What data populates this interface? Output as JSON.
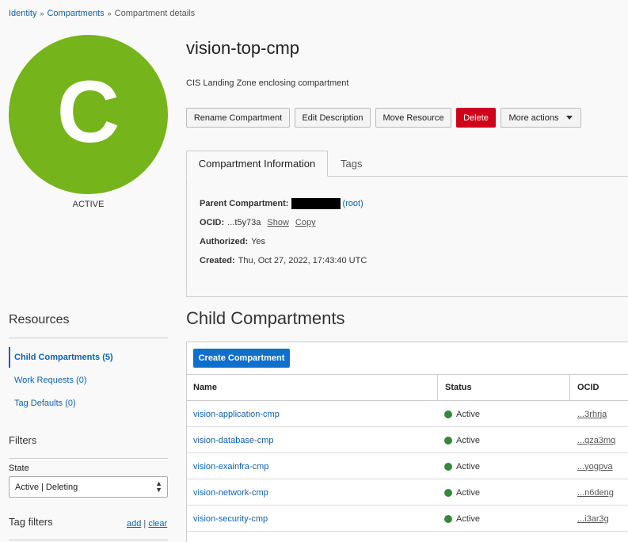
{
  "breadcrumb": {
    "identity": "Identity",
    "compartments": "Compartments",
    "current": "Compartment details",
    "sep": "»"
  },
  "avatar": {
    "letter": "C",
    "status": "ACTIVE",
    "color": "#76b41b"
  },
  "header": {
    "title": "vision-top-cmp",
    "description": "CIS Landing Zone enclosing compartment"
  },
  "actions": {
    "rename": "Rename Compartment",
    "edit": "Edit Description",
    "move": "Move Resource",
    "delete": "Delete",
    "more": "More actions"
  },
  "tabs": {
    "info": "Compartment Information",
    "tags": "Tags"
  },
  "info": {
    "parent_label": "Parent Compartment:",
    "parent_value": "(root)",
    "ocid_label": "OCID:",
    "ocid_value": "...t5y73a",
    "show": "Show",
    "copy": "Copy",
    "authorized_label": "Authorized:",
    "authorized_value": "Yes",
    "created_label": "Created:",
    "created_value": "Thu, Oct 27, 2022, 17:43:40 UTC"
  },
  "resources": {
    "heading": "Resources",
    "items": [
      {
        "label": "Child Compartments (5)"
      },
      {
        "label": "Work Requests (0)"
      },
      {
        "label": "Tag Defaults (0)"
      }
    ]
  },
  "filters": {
    "heading": "Filters",
    "state_label": "State",
    "state_value": "Active | Deleting",
    "tag_filters": "Tag filters",
    "add": "add",
    "divider": "|",
    "clear": "clear"
  },
  "child": {
    "heading": "Child Compartments",
    "create": "Create Compartment",
    "columns": {
      "name": "Name",
      "status": "Status",
      "ocid": "OCID"
    },
    "rows": [
      {
        "name": "vision-application-cmp",
        "status": "Active",
        "ocid": "...3rhrja"
      },
      {
        "name": "vision-database-cmp",
        "status": "Active",
        "ocid": "...qza3mq"
      },
      {
        "name": "vision-exainfra-cmp",
        "status": "Active",
        "ocid": "...yogpva"
      },
      {
        "name": "vision-network-cmp",
        "status": "Active",
        "ocid": "...n6deng"
      },
      {
        "name": "vision-security-cmp",
        "status": "Active",
        "ocid": "...i3ar3g"
      }
    ]
  },
  "colors": {
    "link": "#0e62ad",
    "danger": "#d0021b",
    "primary": "#0f6fcd",
    "active_dot": "#38853d"
  }
}
